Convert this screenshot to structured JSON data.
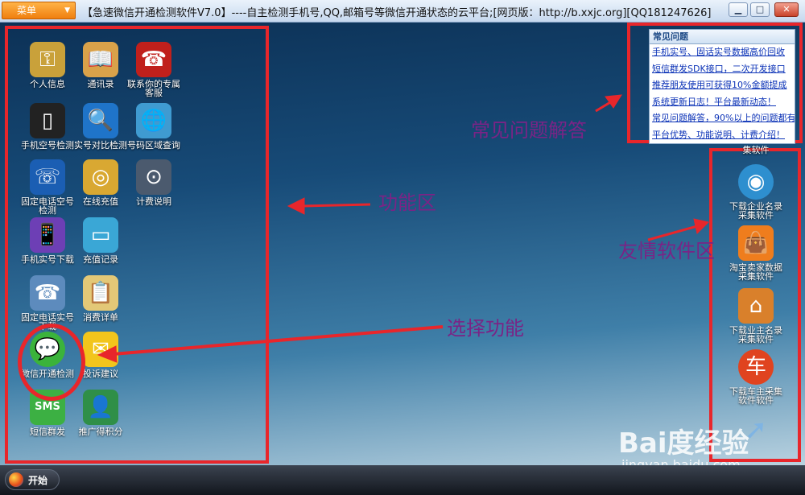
{
  "titlebar": {
    "menu_label": "菜单",
    "title": "【急速微信开通检测软件V7.0】----自主检测手机号,QQ,邮箱号等微信开通状态的云平台;[网页版：http://b.xxjc.org][QQ181247626]"
  },
  "left_icons": [
    {
      "label": "个人信息",
      "icon": "keys-icon"
    },
    {
      "label": "通讯录",
      "icon": "book-icon"
    },
    {
      "label": "联系你的专属客服",
      "icon": "phone-icon"
    },
    {
      "label": "手机空号检测",
      "icon": "mobile-icon"
    },
    {
      "label": "实号对比检测",
      "icon": "magnifier-icon"
    },
    {
      "label": "号码区域查询",
      "icon": "globe-icon"
    },
    {
      "label": "固定电话空号检测",
      "icon": "telephone-icon"
    },
    {
      "label": "在线充值",
      "icon": "coins-icon"
    },
    {
      "label": "计费说明",
      "icon": "gauge-icon"
    },
    {
      "label": "手机实号下载",
      "icon": "cellphone-icon"
    },
    {
      "label": "充值记录",
      "icon": "card-icon"
    },
    {
      "label": "固定电话实号下载",
      "icon": "desk-phone-icon"
    },
    {
      "label": "消费详单",
      "icon": "clipboard-icon"
    },
    {
      "label": "微信开通检测",
      "icon": "wechat-icon"
    },
    {
      "label": "投诉建议",
      "icon": "envelope-icon"
    },
    {
      "label": "短信群发",
      "icon": "sms-icon"
    },
    {
      "label": "推广得积分",
      "icon": "person-icon"
    }
  ],
  "faq": {
    "title": "常见问题",
    "items": [
      "手机实号、固话实号数据高价回收",
      "短信群发SDK接口，二次开发接口",
      "推荐朋友使用可获得10%金额提成",
      "系统更新日志！平台最新动态！",
      "常见问题解答，90%以上的问题都有",
      "平台优势、功能说明、计费介绍！"
    ]
  },
  "right_icons": [
    {
      "label": "集软件",
      "icon": "partial-icon"
    },
    {
      "label": "下载企业名录采集软件",
      "icon": "eye-magnifier-icon"
    },
    {
      "label": "淘宝卖家数据采集软件",
      "icon": "shopping-bag-icon"
    },
    {
      "label": "下载业主名录采集软件",
      "icon": "house-icon"
    },
    {
      "label": "下载车主采集软件软件",
      "icon": "car-owner-icon"
    },
    {
      "label": "",
      "icon": "arrow-cursor-icon"
    }
  ],
  "annotations": {
    "function_area": "功能区",
    "faq_answer": "常见问题解答",
    "friend_software": "友情软件区",
    "select_function": "选择功能"
  },
  "taskbar": {
    "start_label": "开始"
  },
  "watermark": {
    "main": "Bai度经验",
    "sub": "jingyan.baidu.com"
  },
  "colors": {
    "annotation_red": "#e8262b",
    "annotation_text": "#7a2486",
    "faq_link": "#0c33b7"
  }
}
